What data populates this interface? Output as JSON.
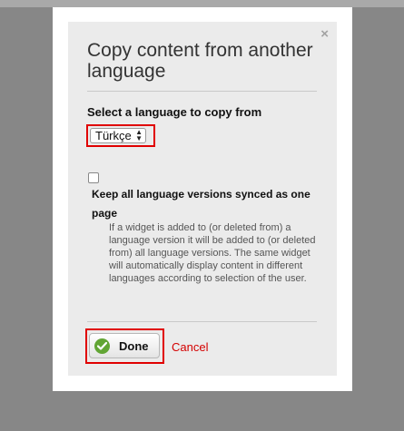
{
  "dialog": {
    "title": "Copy content from another language",
    "close_symbol": "×",
    "select_label": "Select a language to copy from",
    "language_select": {
      "selected": "Türkçe",
      "arrow_up": "▲",
      "arrow_down": "▼"
    },
    "sync_checkbox": {
      "checked": false,
      "label": "Keep all language versions synced as one page",
      "help": "If a widget is added to (or deleted from) a language version it will be added to (or deleted from) all language versions. The same widget will automatically display content in different languages according to selection of the user."
    },
    "buttons": {
      "done_label": "Done",
      "done_icon": "check-circle-icon",
      "cancel_label": "Cancel"
    }
  },
  "colors": {
    "backdrop": "#878787",
    "panel": "#ebebeb",
    "highlight": "#e00000",
    "cancel": "#d40000",
    "check": "#62a534"
  }
}
